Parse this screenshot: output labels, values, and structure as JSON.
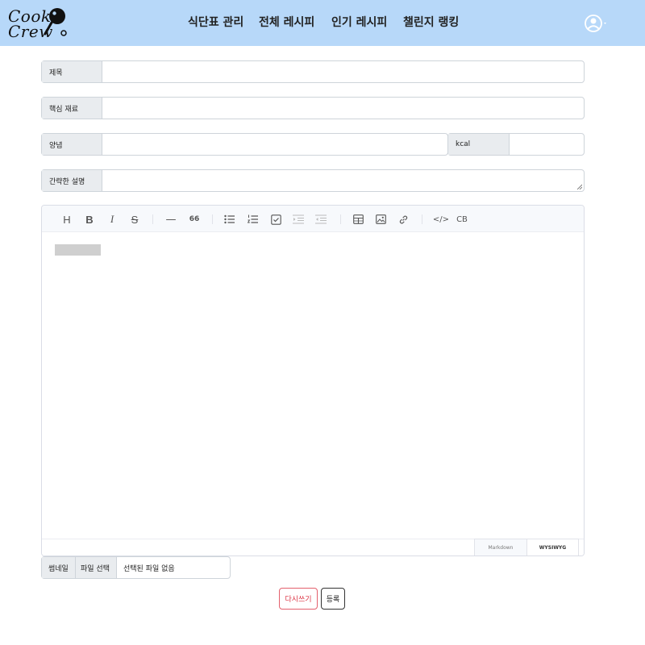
{
  "header": {
    "logo": {
      "line1": "Cook",
      "line2": "Crew"
    },
    "nav": [
      {
        "label": "식단표 관리"
      },
      {
        "label": "전체 레시피"
      },
      {
        "label": "인기 레시피"
      },
      {
        "label": "챌린지 랭킹"
      }
    ],
    "profile_icon": "user-circle-icon",
    "colors": {
      "header_bg": "#b7d8f9"
    }
  },
  "form": {
    "title": {
      "label": "제목",
      "value": ""
    },
    "ingredients": {
      "label": "핵심 재료",
      "value": ""
    },
    "amount": {
      "label": "양념",
      "value": ""
    },
    "kcal": {
      "label": "kcal",
      "value": ""
    },
    "description": {
      "label": "간략한 설명",
      "value": ""
    }
  },
  "editor": {
    "toolbar": [
      {
        "name": "heading-icon",
        "glyph": "H"
      },
      {
        "name": "bold-icon",
        "glyph": "B"
      },
      {
        "name": "italic-icon",
        "glyph": "I"
      },
      {
        "name": "strike-icon",
        "glyph": "S"
      },
      {
        "name": "hr-icon",
        "glyph": "—"
      },
      {
        "name": "quote-icon",
        "glyph": "66"
      },
      {
        "name": "bullet-list-icon",
        "glyph": ""
      },
      {
        "name": "ordered-list-icon",
        "glyph": ""
      },
      {
        "name": "task-list-icon",
        "glyph": ""
      },
      {
        "name": "outdent-icon",
        "glyph": ""
      },
      {
        "name": "indent-icon",
        "glyph": ""
      },
      {
        "name": "table-icon",
        "glyph": ""
      },
      {
        "name": "image-icon",
        "glyph": ""
      },
      {
        "name": "link-icon",
        "glyph": ""
      },
      {
        "name": "code-icon",
        "glyph": "</>"
      },
      {
        "name": "code-block-icon",
        "glyph": "CB"
      }
    ],
    "modes": {
      "markdown": "Markdown",
      "wysiwyg": "WYSIWYG",
      "active": "WYSIWYG"
    }
  },
  "file": {
    "label": "썸네일",
    "choose": "파일 선택",
    "status": "선택된 파일 없음"
  },
  "buttons": {
    "reset": "다시쓰기",
    "submit": "등록"
  }
}
